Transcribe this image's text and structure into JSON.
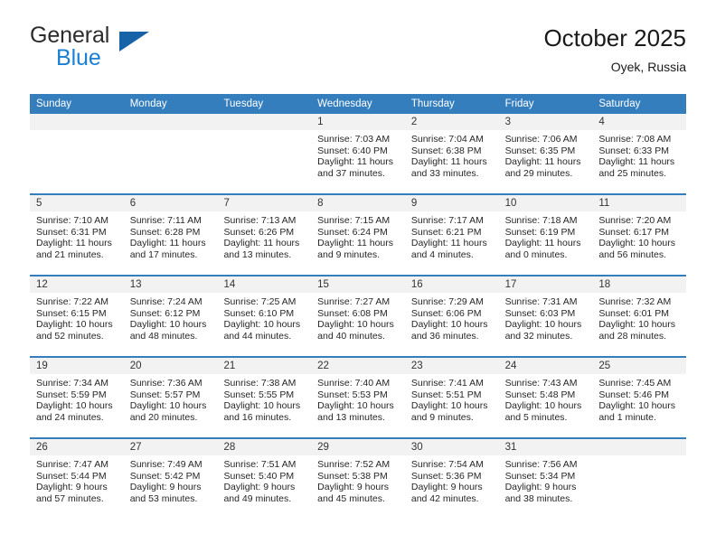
{
  "brand": {
    "line1": "General",
    "line2": "Blue",
    "triangle_color": "#1763a8",
    "blue_text_color": "#1b7fd4"
  },
  "header": {
    "title": "October 2025",
    "subtitle": "Oyek, Russia"
  },
  "theme": {
    "header_row_bg": "#357ebd",
    "daynum_band_bg": "#f2f2f2",
    "row_divider": "#357ebd"
  },
  "weekdays": [
    "Sunday",
    "Monday",
    "Tuesday",
    "Wednesday",
    "Thursday",
    "Friday",
    "Saturday"
  ],
  "weeks": [
    [
      {
        "day": "",
        "lines": []
      },
      {
        "day": "",
        "lines": []
      },
      {
        "day": "",
        "lines": []
      },
      {
        "day": "1",
        "lines": [
          "Sunrise: 7:03 AM",
          "Sunset: 6:40 PM",
          "Daylight: 11 hours",
          "and 37 minutes."
        ]
      },
      {
        "day": "2",
        "lines": [
          "Sunrise: 7:04 AM",
          "Sunset: 6:38 PM",
          "Daylight: 11 hours",
          "and 33 minutes."
        ]
      },
      {
        "day": "3",
        "lines": [
          "Sunrise: 7:06 AM",
          "Sunset: 6:35 PM",
          "Daylight: 11 hours",
          "and 29 minutes."
        ]
      },
      {
        "day": "4",
        "lines": [
          "Sunrise: 7:08 AM",
          "Sunset: 6:33 PM",
          "Daylight: 11 hours",
          "and 25 minutes."
        ]
      }
    ],
    [
      {
        "day": "5",
        "lines": [
          "Sunrise: 7:10 AM",
          "Sunset: 6:31 PM",
          "Daylight: 11 hours",
          "and 21 minutes."
        ]
      },
      {
        "day": "6",
        "lines": [
          "Sunrise: 7:11 AM",
          "Sunset: 6:28 PM",
          "Daylight: 11 hours",
          "and 17 minutes."
        ]
      },
      {
        "day": "7",
        "lines": [
          "Sunrise: 7:13 AM",
          "Sunset: 6:26 PM",
          "Daylight: 11 hours",
          "and 13 minutes."
        ]
      },
      {
        "day": "8",
        "lines": [
          "Sunrise: 7:15 AM",
          "Sunset: 6:24 PM",
          "Daylight: 11 hours",
          "and 9 minutes."
        ]
      },
      {
        "day": "9",
        "lines": [
          "Sunrise: 7:17 AM",
          "Sunset: 6:21 PM",
          "Daylight: 11 hours",
          "and 4 minutes."
        ]
      },
      {
        "day": "10",
        "lines": [
          "Sunrise: 7:18 AM",
          "Sunset: 6:19 PM",
          "Daylight: 11 hours",
          "and 0 minutes."
        ]
      },
      {
        "day": "11",
        "lines": [
          "Sunrise: 7:20 AM",
          "Sunset: 6:17 PM",
          "Daylight: 10 hours",
          "and 56 minutes."
        ]
      }
    ],
    [
      {
        "day": "12",
        "lines": [
          "Sunrise: 7:22 AM",
          "Sunset: 6:15 PM",
          "Daylight: 10 hours",
          "and 52 minutes."
        ]
      },
      {
        "day": "13",
        "lines": [
          "Sunrise: 7:24 AM",
          "Sunset: 6:12 PM",
          "Daylight: 10 hours",
          "and 48 minutes."
        ]
      },
      {
        "day": "14",
        "lines": [
          "Sunrise: 7:25 AM",
          "Sunset: 6:10 PM",
          "Daylight: 10 hours",
          "and 44 minutes."
        ]
      },
      {
        "day": "15",
        "lines": [
          "Sunrise: 7:27 AM",
          "Sunset: 6:08 PM",
          "Daylight: 10 hours",
          "and 40 minutes."
        ]
      },
      {
        "day": "16",
        "lines": [
          "Sunrise: 7:29 AM",
          "Sunset: 6:06 PM",
          "Daylight: 10 hours",
          "and 36 minutes."
        ]
      },
      {
        "day": "17",
        "lines": [
          "Sunrise: 7:31 AM",
          "Sunset: 6:03 PM",
          "Daylight: 10 hours",
          "and 32 minutes."
        ]
      },
      {
        "day": "18",
        "lines": [
          "Sunrise: 7:32 AM",
          "Sunset: 6:01 PM",
          "Daylight: 10 hours",
          "and 28 minutes."
        ]
      }
    ],
    [
      {
        "day": "19",
        "lines": [
          "Sunrise: 7:34 AM",
          "Sunset: 5:59 PM",
          "Daylight: 10 hours",
          "and 24 minutes."
        ]
      },
      {
        "day": "20",
        "lines": [
          "Sunrise: 7:36 AM",
          "Sunset: 5:57 PM",
          "Daylight: 10 hours",
          "and 20 minutes."
        ]
      },
      {
        "day": "21",
        "lines": [
          "Sunrise: 7:38 AM",
          "Sunset: 5:55 PM",
          "Daylight: 10 hours",
          "and 16 minutes."
        ]
      },
      {
        "day": "22",
        "lines": [
          "Sunrise: 7:40 AM",
          "Sunset: 5:53 PM",
          "Daylight: 10 hours",
          "and 13 minutes."
        ]
      },
      {
        "day": "23",
        "lines": [
          "Sunrise: 7:41 AM",
          "Sunset: 5:51 PM",
          "Daylight: 10 hours",
          "and 9 minutes."
        ]
      },
      {
        "day": "24",
        "lines": [
          "Sunrise: 7:43 AM",
          "Sunset: 5:48 PM",
          "Daylight: 10 hours",
          "and 5 minutes."
        ]
      },
      {
        "day": "25",
        "lines": [
          "Sunrise: 7:45 AM",
          "Sunset: 5:46 PM",
          "Daylight: 10 hours",
          "and 1 minute."
        ]
      }
    ],
    [
      {
        "day": "26",
        "lines": [
          "Sunrise: 7:47 AM",
          "Sunset: 5:44 PM",
          "Daylight: 9 hours",
          "and 57 minutes."
        ]
      },
      {
        "day": "27",
        "lines": [
          "Sunrise: 7:49 AM",
          "Sunset: 5:42 PM",
          "Daylight: 9 hours",
          "and 53 minutes."
        ]
      },
      {
        "day": "28",
        "lines": [
          "Sunrise: 7:51 AM",
          "Sunset: 5:40 PM",
          "Daylight: 9 hours",
          "and 49 minutes."
        ]
      },
      {
        "day": "29",
        "lines": [
          "Sunrise: 7:52 AM",
          "Sunset: 5:38 PM",
          "Daylight: 9 hours",
          "and 45 minutes."
        ]
      },
      {
        "day": "30",
        "lines": [
          "Sunrise: 7:54 AM",
          "Sunset: 5:36 PM",
          "Daylight: 9 hours",
          "and 42 minutes."
        ]
      },
      {
        "day": "31",
        "lines": [
          "Sunrise: 7:56 AM",
          "Sunset: 5:34 PM",
          "Daylight: 9 hours",
          "and 38 minutes."
        ]
      },
      {
        "day": "",
        "lines": []
      }
    ]
  ]
}
